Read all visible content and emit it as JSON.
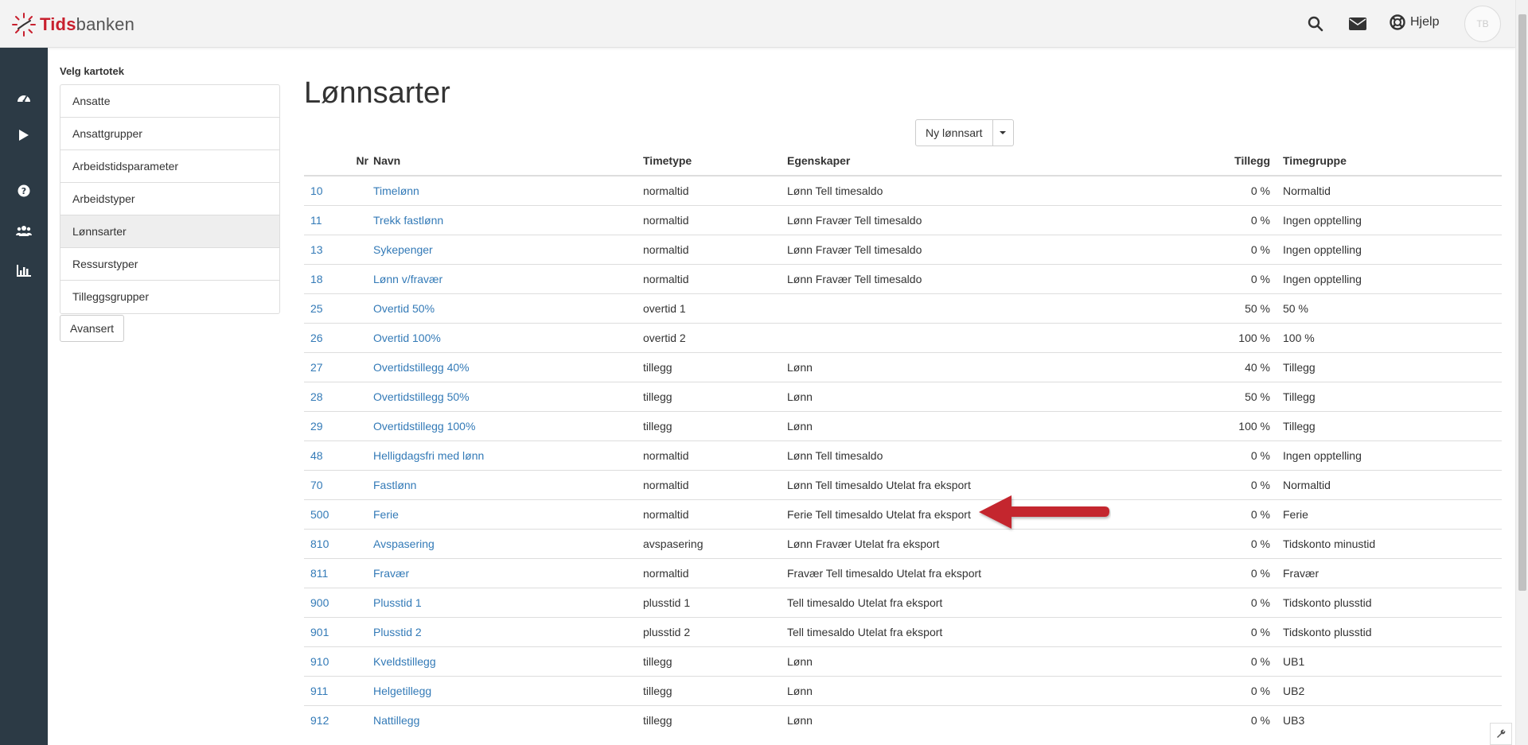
{
  "app": {
    "logo_bold": "Tids",
    "logo_rest": "banken",
    "help_label": "Hjelp",
    "avatar_initials": "TB"
  },
  "icons": {
    "top": [
      "search-icon",
      "mail-icon",
      "lifebuoy-icon"
    ],
    "nav": [
      "dashboard-icon",
      "play-icon",
      "question-icon",
      "users-icon",
      "bar-chart-icon"
    ]
  },
  "sidebar": {
    "title": "Velg kartotek",
    "items": [
      {
        "label": "Ansatte",
        "active": false
      },
      {
        "label": "Ansattgrupper",
        "active": false
      },
      {
        "label": "Arbeidstidsparameter",
        "active": false
      },
      {
        "label": "Arbeidstyper",
        "active": false
      },
      {
        "label": "Lønnsarter",
        "active": true
      },
      {
        "label": "Ressurstyper",
        "active": false
      },
      {
        "label": "Tilleggsgrupper",
        "active": false
      }
    ],
    "advanced_button": "Avansert"
  },
  "main": {
    "title": "Lønnsarter",
    "new_button": "Ny lønnsart",
    "columns": {
      "nr": "Nr",
      "navn": "Navn",
      "timetype": "Timetype",
      "egenskaper": "Egenskaper",
      "tillegg": "Tillegg",
      "timegruppe": "Timegruppe"
    },
    "rows": [
      {
        "nr": "10",
        "navn": "Timelønn",
        "timetype": "normaltid",
        "egenskaper": "Lønn Tell timesaldo",
        "tillegg": "0 %",
        "timegruppe": "Normaltid"
      },
      {
        "nr": "11",
        "navn": "Trekk fastlønn",
        "timetype": "normaltid",
        "egenskaper": "Lønn Fravær Tell timesaldo",
        "tillegg": "0 %",
        "timegruppe": "Ingen opptelling"
      },
      {
        "nr": "13",
        "navn": "Sykepenger",
        "timetype": "normaltid",
        "egenskaper": "Lønn Fravær Tell timesaldo",
        "tillegg": "0 %",
        "timegruppe": "Ingen opptelling"
      },
      {
        "nr": "18",
        "navn": "Lønn v/fravær",
        "timetype": "normaltid",
        "egenskaper": "Lønn Fravær Tell timesaldo",
        "tillegg": "0 %",
        "timegruppe": "Ingen opptelling"
      },
      {
        "nr": "25",
        "navn": "Overtid 50%",
        "timetype": "overtid 1",
        "egenskaper": "",
        "tillegg": "50 %",
        "timegruppe": "50 %"
      },
      {
        "nr": "26",
        "navn": "Overtid 100%",
        "timetype": "overtid 2",
        "egenskaper": "",
        "tillegg": "100 %",
        "timegruppe": "100 %"
      },
      {
        "nr": "27",
        "navn": "Overtidstillegg 40%",
        "timetype": "tillegg",
        "egenskaper": "Lønn",
        "tillegg": "40 %",
        "timegruppe": "Tillegg"
      },
      {
        "nr": "28",
        "navn": "Overtidstillegg 50%",
        "timetype": "tillegg",
        "egenskaper": "Lønn",
        "tillegg": "50 %",
        "timegruppe": "Tillegg"
      },
      {
        "nr": "29",
        "navn": "Overtidstillegg 100%",
        "timetype": "tillegg",
        "egenskaper": "Lønn",
        "tillegg": "100 %",
        "timegruppe": "Tillegg"
      },
      {
        "nr": "48",
        "navn": "Helligdagsfri med lønn",
        "timetype": "normaltid",
        "egenskaper": "Lønn Tell timesaldo",
        "tillegg": "0 %",
        "timegruppe": "Ingen opptelling"
      },
      {
        "nr": "70",
        "navn": "Fastlønn",
        "timetype": "normaltid",
        "egenskaper": "Lønn Tell timesaldo Utelat fra eksport",
        "tillegg": "0 %",
        "timegruppe": "Normaltid"
      },
      {
        "nr": "500",
        "navn": "Ferie",
        "timetype": "normaltid",
        "egenskaper": "Ferie Tell timesaldo Utelat fra eksport",
        "tillegg": "0 %",
        "timegruppe": "Ferie"
      },
      {
        "nr": "810",
        "navn": "Avspasering",
        "timetype": "avspasering",
        "egenskaper": "Lønn Fravær Utelat fra eksport",
        "tillegg": "0 %",
        "timegruppe": "Tidskonto minustid"
      },
      {
        "nr": "811",
        "navn": "Fravær",
        "timetype": "normaltid",
        "egenskaper": "Fravær Tell timesaldo Utelat fra eksport",
        "tillegg": "0 %",
        "timegruppe": "Fravær"
      },
      {
        "nr": "900",
        "navn": "Plusstid 1",
        "timetype": "plusstid 1",
        "egenskaper": "Tell timesaldo Utelat fra eksport",
        "tillegg": "0 %",
        "timegruppe": "Tidskonto plusstid"
      },
      {
        "nr": "901",
        "navn": "Plusstid 2",
        "timetype": "plusstid 2",
        "egenskaper": "Tell timesaldo Utelat fra eksport",
        "tillegg": "0 %",
        "timegruppe": "Tidskonto plusstid"
      },
      {
        "nr": "910",
        "navn": "Kveldstillegg",
        "timetype": "tillegg",
        "egenskaper": "Lønn",
        "tillegg": "0 %",
        "timegruppe": "UB1"
      },
      {
        "nr": "911",
        "navn": "Helgetillegg",
        "timetype": "tillegg",
        "egenskaper": "Lønn",
        "tillegg": "0 %",
        "timegruppe": "UB2"
      },
      {
        "nr": "912",
        "navn": "Nattillegg",
        "timetype": "tillegg",
        "egenskaper": "Lønn",
        "tillegg": "0 %",
        "timegruppe": "UB3"
      }
    ]
  },
  "colors": {
    "brand_red": "#c8202e",
    "link": "#337ab7",
    "nav_bg": "#2c3a45",
    "arrow": "#c4262e"
  }
}
